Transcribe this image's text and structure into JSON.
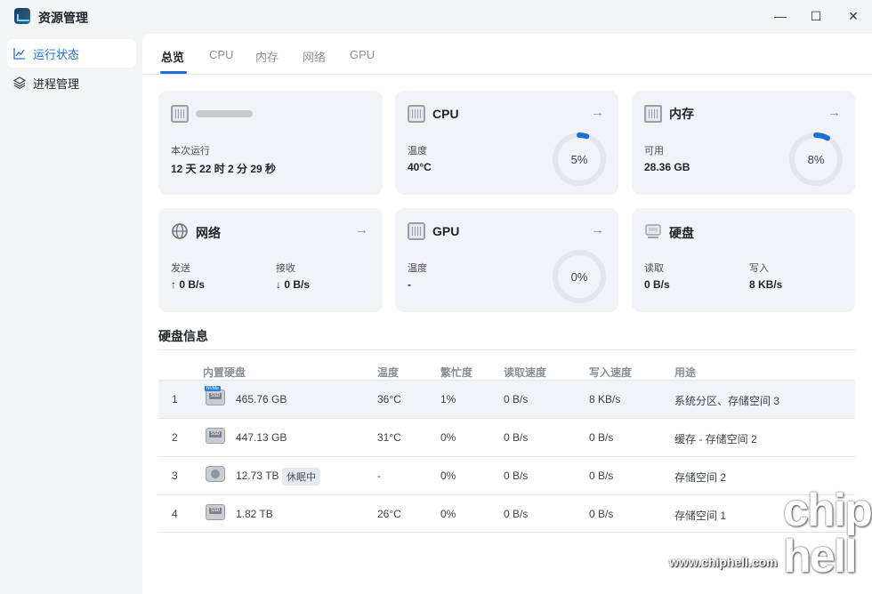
{
  "window": {
    "title": "资源管理",
    "minimize_glyph": "—",
    "maximize_glyph": "☐",
    "close_glyph": "✕"
  },
  "sidebar": {
    "items": [
      {
        "label": "运行状态",
        "icon": "line-chart-icon",
        "active": true
      },
      {
        "label": "进程管理",
        "icon": "layers-icon",
        "active": false
      }
    ]
  },
  "tabs": [
    "总览",
    "CPU",
    "内存",
    "网络",
    "GPU"
  ],
  "cards": {
    "system": {
      "uptime_label": "本次运行",
      "uptime_value": "12 天 22 时 2 分 29 秒"
    },
    "cpu": {
      "title": "CPU",
      "temp_label": "温度",
      "temp_value": "40°C",
      "usage_text": "5%",
      "usage": 5
    },
    "memory": {
      "title": "内存",
      "avail_label": "可用",
      "avail_value": "28.36 GB",
      "usage_text": "8%",
      "usage": 8
    },
    "network": {
      "title": "网络",
      "send_label": "发送",
      "send_value": "↑ 0 B/s",
      "recv_label": "接收",
      "recv_value": "↓ 0 B/s"
    },
    "gpu": {
      "title": "GPU",
      "temp_label": "温度",
      "temp_value": "-",
      "usage_text": "0%",
      "usage": 0
    },
    "disk": {
      "title": "硬盘",
      "read_label": "读取",
      "read_value": "0 B/s",
      "write_label": "写入",
      "write_value": "8 KB/s"
    }
  },
  "disk_section": {
    "title": "硬盘信息",
    "headers": [
      "内置硬盘",
      "温度",
      "繁忙度",
      "读取速度",
      "写入速度",
      "用途"
    ],
    "rows": [
      {
        "index": "1",
        "type": "nvme",
        "size": "465.76 GB",
        "temp": "36°C",
        "busy": "1%",
        "read": "0 B/s",
        "write": "8 KB/s",
        "usage": "系统分区、存储空间 3",
        "badge": ""
      },
      {
        "index": "2",
        "type": "ssd",
        "size": "447.13 GB",
        "temp": "31°C",
        "busy": "0%",
        "read": "0 B/s",
        "write": "0 B/s",
        "usage": "缓存 - 存储空间 2",
        "badge": ""
      },
      {
        "index": "3",
        "type": "hdd",
        "size": "12.73 TB",
        "temp": "-",
        "busy": "0%",
        "read": "0 B/s",
        "write": "0 B/s",
        "usage": "存储空间 2",
        "badge": "休眠中"
      },
      {
        "index": "4",
        "type": "ssd",
        "size": "1.82 TB",
        "temp": "26°C",
        "busy": "0%",
        "read": "0 B/s",
        "write": "0 B/s",
        "usage": "存储空间 1",
        "badge": ""
      }
    ]
  },
  "watermark": {
    "big": "chip\nhell",
    "url": "www.chiphell.com"
  },
  "colors": {
    "accent": "#1d6fd8",
    "ring_track": "#e3e6eb"
  }
}
